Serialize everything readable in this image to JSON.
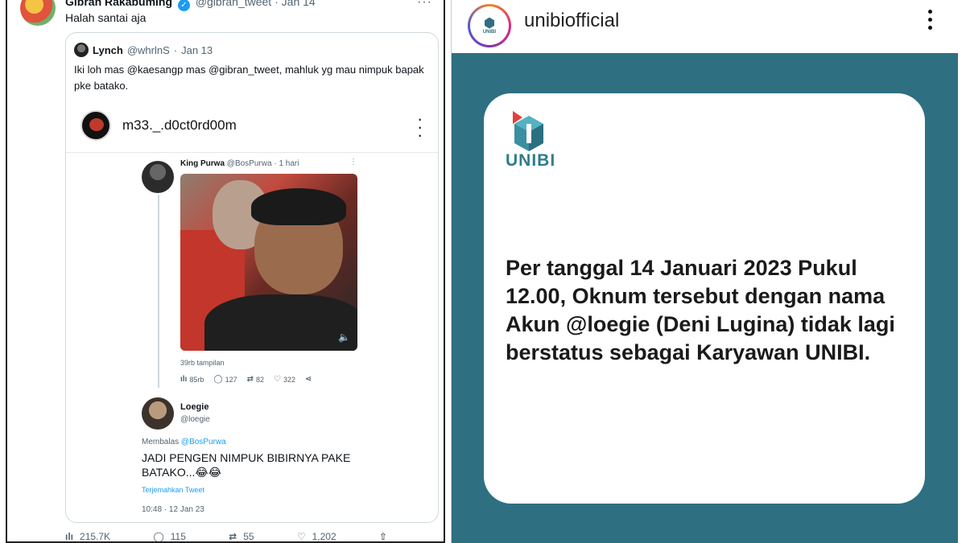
{
  "twitter": {
    "author_name": "Gibran Rakabuming",
    "author_handle": "@gibran_tweet",
    "author_date": "Jan 14",
    "more": "···",
    "text": "Halah santai aja",
    "quote": {
      "name": "Lynch",
      "handle": "@whrlnS",
      "date": "Jan 13",
      "text": "Iki loh mas @kaesangp mas @gibran_tweet, mahluk yg mau nimpuk bapak pke batako."
    },
    "embedded_ig": {
      "username": "m33._.d0ct0rd00m",
      "tweet": {
        "name": "King Purwa",
        "handle": "@BosPurwa",
        "time": "1 hari",
        "more": "⋮",
        "views": "39rb tampilan",
        "views_count": "85rb",
        "replies": "127",
        "retweets": "82",
        "likes": "322"
      },
      "reply": {
        "name": "Loegie",
        "handle": "@loegie",
        "replying_prefix": "Membalas",
        "replying_to": "@BosPurwa",
        "text": "JADI PENGEN NIMPUK BIBIRNYA PAKE BATAKO...😂😂",
        "translate": "Terjemahkan Tweet",
        "timestamp": "10:48 · 12 Jan 23"
      }
    },
    "actions": {
      "views": "215.7K",
      "replies": "115",
      "retweets": "55",
      "likes": "1,202"
    }
  },
  "instagram": {
    "username": "unibiofficial",
    "avatar_text": "UNIBI",
    "post": {
      "brand": "UNIBI",
      "text": "Per tanggal 14 Januari 2023 Pukul 12.00, Oknum tersebut dengan nama Akun @loegie (Deni Lugina)  tidak lagi berstatus sebagai Karyawan UNIBI.",
      "background_color": "#2f6f82"
    }
  },
  "icons": {
    "views": "bar-chart-icon",
    "reply": "speech-bubble-icon",
    "retweet": "retweet-icon",
    "like": "heart-icon",
    "share": "share-icon",
    "verified": "verified-badge-icon"
  }
}
